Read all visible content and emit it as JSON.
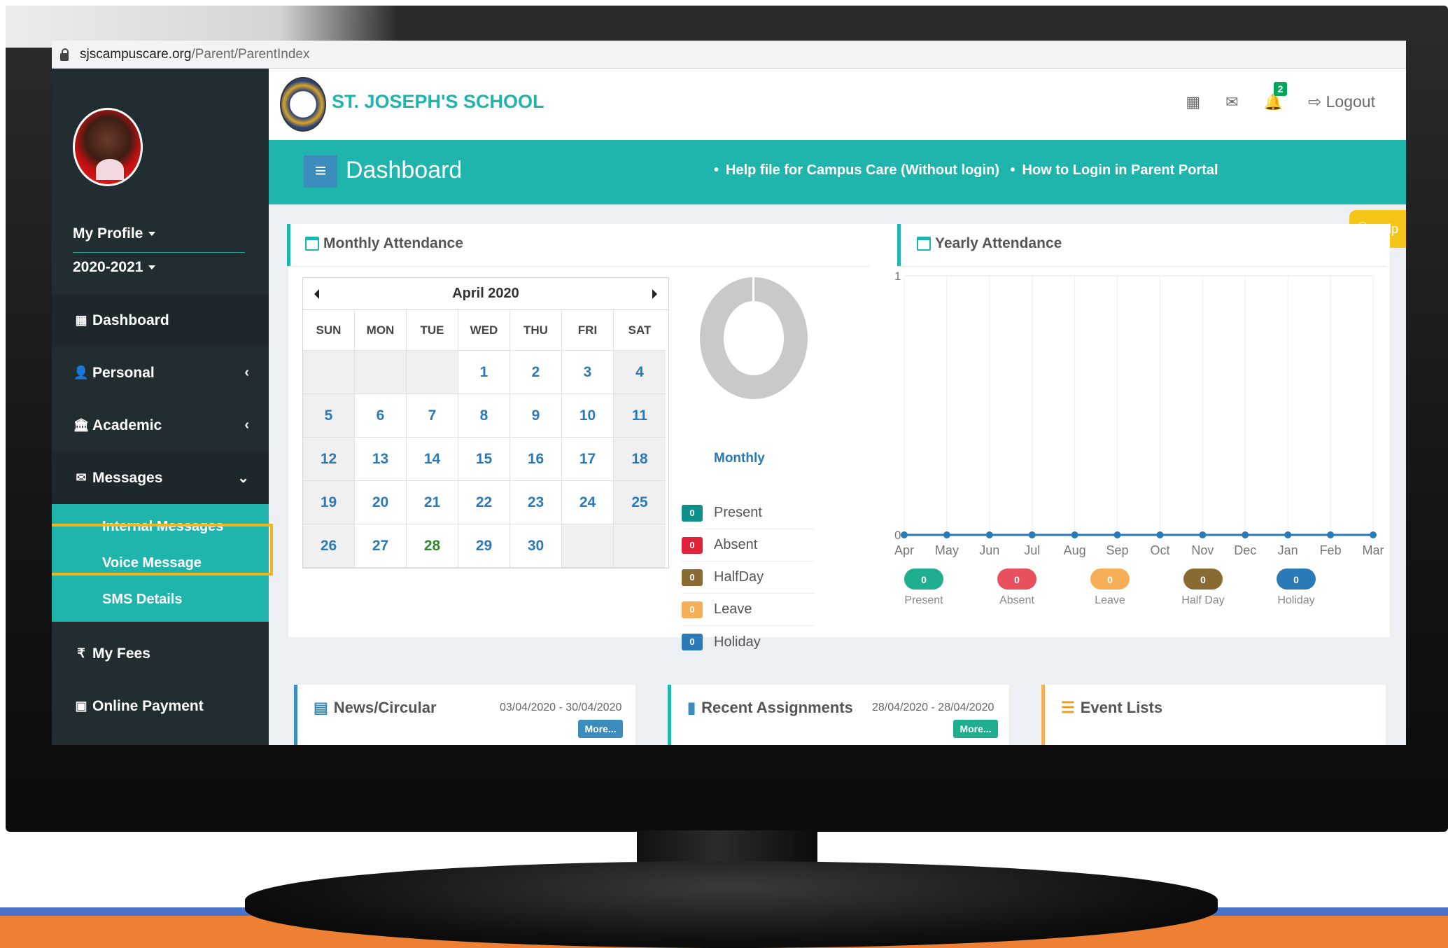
{
  "browser": {
    "url_domain": "sjscampuscare.org",
    "url_path": "/Parent/ParentIndex"
  },
  "sidebar": {
    "profile_label": "My Profile",
    "year_label": "2020-2021",
    "items": [
      {
        "label": "Dashboard",
        "icon": "grid-icon"
      },
      {
        "label": "Personal",
        "icon": "user-icon"
      },
      {
        "label": "Academic",
        "icon": "bank-icon"
      },
      {
        "label": "Messages",
        "icon": "envelope-icon"
      },
      {
        "label": "My Fees",
        "icon": "rupee-icon"
      },
      {
        "label": "Online Payment",
        "icon": "money-icon"
      }
    ],
    "submenu": [
      "Internal Messages",
      "Voice Message",
      "SMS Details"
    ]
  },
  "header": {
    "school_name": "ST. JOSEPH'S SCHOOL",
    "notification_count": "2",
    "logout_label": "Logout"
  },
  "dashbar": {
    "title": "Dashboard",
    "link1": "Help file for Campus Care (Without login)",
    "link2": "How to Login in Parent Portal",
    "help_tab": "Help"
  },
  "monthly": {
    "title": "Monthly Attendance",
    "month": "April 2020",
    "days_of_week": [
      "SUN",
      "MON",
      "TUE",
      "WED",
      "THU",
      "FRI",
      "SAT"
    ],
    "weeks": [
      [
        "",
        "",
        "",
        "1",
        "2",
        "3",
        "4"
      ],
      [
        "5",
        "6",
        "7",
        "8",
        "9",
        "10",
        "11"
      ],
      [
        "12",
        "13",
        "14",
        "15",
        "16",
        "17",
        "18"
      ],
      [
        "19",
        "20",
        "21",
        "22",
        "23",
        "24",
        "25"
      ],
      [
        "26",
        "27",
        "28",
        "29",
        "30",
        "",
        ""
      ]
    ],
    "today": "28",
    "donut_label": "Monthly",
    "legend": [
      {
        "label": "Present",
        "value": "0",
        "color": "#0d8f8a"
      },
      {
        "label": "Absent",
        "value": "0",
        "color": "#e0233b"
      },
      {
        "label": "HalfDay",
        "value": "0",
        "color": "#8a6a33"
      },
      {
        "label": "Leave",
        "value": "0",
        "color": "#f6ae57"
      },
      {
        "label": "Holiday",
        "value": "0",
        "color": "#2a7ab8"
      }
    ]
  },
  "yearly": {
    "title": "Yearly Attendance"
  },
  "chart_data": {
    "type": "line",
    "x": [
      "Apr",
      "May",
      "Jun",
      "Jul",
      "Aug",
      "Sep",
      "Oct",
      "Nov",
      "Dec",
      "Jan",
      "Feb",
      "Mar"
    ],
    "series": [
      {
        "name": "Present",
        "values": [
          0,
          0,
          0,
          0,
          0,
          0,
          0,
          0,
          0,
          0,
          0,
          0
        ]
      }
    ],
    "ylim": [
      0,
      1
    ],
    "yticks": [
      "0",
      "1"
    ],
    "grid": true,
    "legend": [
      {
        "label": "Present",
        "value": "0",
        "color": "#1fae8e"
      },
      {
        "label": "Absent",
        "value": "0",
        "color": "#e8505e"
      },
      {
        "label": "Leave",
        "value": "0",
        "color": "#f6ae57"
      },
      {
        "label": "Half Day",
        "value": "0",
        "color": "#8a6a33"
      },
      {
        "label": "Holiday",
        "value": "0",
        "color": "#2a7ab8"
      }
    ],
    "line_color": "#2a7ab8"
  },
  "news": {
    "title": "News/Circular",
    "date": "03/04/2020 - 30/04/2020",
    "more": "More..."
  },
  "assignments": {
    "title": "Recent Assignments",
    "date": "28/04/2020 - 28/04/2020",
    "more": "More..."
  },
  "events": {
    "title": "Event Lists"
  }
}
